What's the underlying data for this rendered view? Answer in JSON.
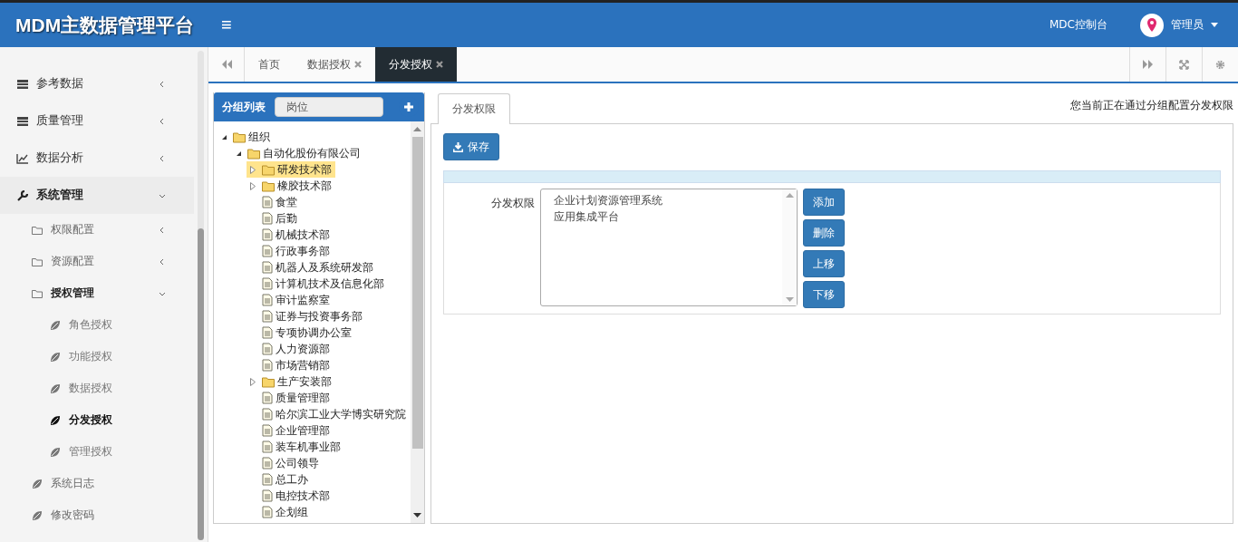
{
  "header": {
    "title": "MDM主数据管理平台",
    "menu_glyph": "≡",
    "console_link": "MDC控制台",
    "user": "管理员"
  },
  "sidebar": {
    "items": [
      {
        "label": "参考数据",
        "expanded": false
      },
      {
        "label": "质量管理",
        "expanded": false
      },
      {
        "label": "数据分析",
        "expanded": false
      },
      {
        "label": "系统管理",
        "expanded": true,
        "children": [
          {
            "label": "权限配置",
            "expanded": false
          },
          {
            "label": "资源配置",
            "expanded": false
          },
          {
            "label": "授权管理",
            "expanded": true,
            "children": [
              {
                "label": "角色授权",
                "selected": false
              },
              {
                "label": "功能授权",
                "selected": false
              },
              {
                "label": "数据授权",
                "selected": false
              },
              {
                "label": "分发授权",
                "selected": true
              },
              {
                "label": "管理授权",
                "selected": false
              }
            ]
          },
          {
            "label": "系统日志",
            "selected": false
          },
          {
            "label": "修改密码",
            "selected": false
          }
        ]
      }
    ]
  },
  "tabs": [
    {
      "label": "首页",
      "closable": false,
      "selected": false
    },
    {
      "label": "数据授权",
      "closable": true,
      "selected": false
    },
    {
      "label": "分发授权",
      "closable": true,
      "selected": true
    }
  ],
  "group_panel": {
    "title": "分组列表",
    "search": {
      "value": "岗位"
    },
    "tree": [
      {
        "label": "组织",
        "kind": "folder",
        "expanded": true,
        "selected": false,
        "children": [
          {
            "label": "自动化股份有限公司",
            "kind": "folder",
            "expanded": true,
            "selected": false,
            "children": [
              {
                "label": "研发技术部",
                "kind": "folder",
                "expanded": false,
                "selected": true
              },
              {
                "label": "橡胶技术部",
                "kind": "folder",
                "expanded": false,
                "selected": false
              },
              {
                "label": "食堂",
                "kind": "file",
                "selected": false
              },
              {
                "label": "后勤",
                "kind": "file",
                "selected": false
              },
              {
                "label": "机械技术部",
                "kind": "file",
                "selected": false
              },
              {
                "label": "行政事务部",
                "kind": "file",
                "selected": false
              },
              {
                "label": "机器人及系统研发部",
                "kind": "file",
                "selected": false
              },
              {
                "label": "计算机技术及信息化部",
                "kind": "file",
                "selected": false
              },
              {
                "label": "审计监察室",
                "kind": "file",
                "selected": false
              },
              {
                "label": "证券与投资事务部",
                "kind": "file",
                "selected": false
              },
              {
                "label": "专项协调办公室",
                "kind": "file",
                "selected": false
              },
              {
                "label": "人力资源部",
                "kind": "file",
                "selected": false
              },
              {
                "label": "市场营销部",
                "kind": "file",
                "selected": false
              },
              {
                "label": "生产安装部",
                "kind": "folder",
                "expanded": false,
                "selected": false
              },
              {
                "label": "质量管理部",
                "kind": "file",
                "selected": false
              },
              {
                "label": "哈尔滨工业大学博实研究院",
                "kind": "file",
                "selected": false
              },
              {
                "label": "企业管理部",
                "kind": "file",
                "selected": false
              },
              {
                "label": "装车机事业部",
                "kind": "file",
                "selected": false
              },
              {
                "label": "公司领导",
                "kind": "file",
                "selected": false
              },
              {
                "label": "总工办",
                "kind": "file",
                "selected": false
              },
              {
                "label": "电控技术部",
                "kind": "file",
                "selected": false
              },
              {
                "label": "企划组",
                "kind": "file",
                "selected": false
              }
            ]
          }
        ]
      }
    ]
  },
  "detail": {
    "tab": {
      "label": "分发权限",
      "selected": true
    },
    "note": "您当前正在通过分组配置分发权限",
    "save_button": "保存",
    "field_label": "分发权限",
    "list_items": [
      "企业计划资源管理系统",
      "应用集成平台"
    ],
    "actions": [
      "添加",
      "删除",
      "上移",
      "下移"
    ]
  }
}
